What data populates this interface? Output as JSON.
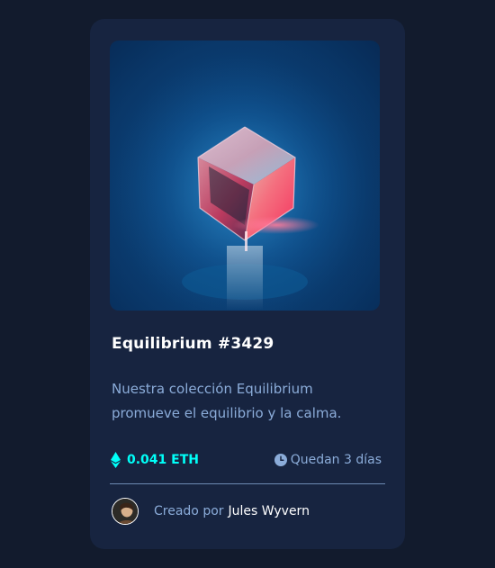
{
  "card": {
    "image_alt": "Equilibrium",
    "title": "Equilibrium #3429",
    "description": "Nuestra colección Equilibrium promueve el equilibrio y la calma.",
    "price": "0.041 ETH",
    "time_left": "Quedan 3 días",
    "creator_label": "Creado por",
    "creator_name": "Jules Wyvern"
  },
  "colors": {
    "page_background": "#121b2d",
    "card_background": "#172440",
    "accent_cyan": "#00fff8",
    "soft_blue": "#8bacd9",
    "white": "#ffffff"
  },
  "icons": {
    "price": "ethereum-icon",
    "time": "clock-icon",
    "avatar": "avatar"
  }
}
